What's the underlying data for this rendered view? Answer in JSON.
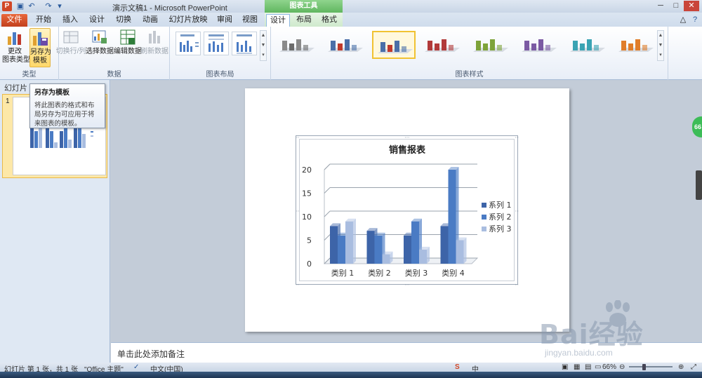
{
  "window": {
    "title": "演示文稿1 - Microsoft PowerPoint",
    "app_icon": "P",
    "context_tab_group": "图表工具"
  },
  "tabs": [
    "文件",
    "开始",
    "插入",
    "设计",
    "切换",
    "动画",
    "幻灯片放映",
    "审阅",
    "视图",
    "设计",
    "布局",
    "格式"
  ],
  "ribbon": {
    "groups": {
      "type": {
        "label": "类型",
        "buttons": [
          "更改\n图表类型",
          "另存为\n模板"
        ]
      },
      "data": {
        "label": "数据",
        "buttons": [
          "切换行/列",
          "选择数据",
          "编辑数据",
          "刷新数据"
        ]
      },
      "layouts": {
        "label": "图表布局"
      },
      "styles": {
        "label": "图表样式"
      }
    },
    "change_type_l1": "更改",
    "change_type_l2": "图表类型",
    "save_template_l1": "另存为",
    "save_template_l2": "模板",
    "switch_row_col": "切换行/列",
    "select_data": "选择数据",
    "edit_data": "编辑数据",
    "refresh_data": "刷新数据",
    "style_colors": [
      "#6b6b6b",
      "#4a6fa8",
      "#4a6fa8",
      "#b23a3a",
      "#7ea33a",
      "#7b5aa3",
      "#3aa3b3",
      "#e07d2a"
    ]
  },
  "slides_pane": {
    "tab_label": "幻灯片",
    "slide_number": "1"
  },
  "tooltip": {
    "title": "另存为模板",
    "body": "将此图表的格式和布局另存为可应用于将来图表的模板。"
  },
  "chart_data": {
    "type": "bar",
    "title": "销售报表",
    "categories": [
      "类别 1",
      "类别 2",
      "类别 3",
      "类别 4"
    ],
    "series": [
      {
        "name": "系列 1",
        "values": [
          8,
          7,
          6,
          8
        ],
        "color": "#3d64a8"
      },
      {
        "name": "系列 2",
        "values": [
          6,
          6,
          9,
          20
        ],
        "color": "#4a7bc4"
      },
      {
        "name": "系列 3",
        "values": [
          9,
          2,
          3,
          5
        ],
        "color": "#a9bde0"
      }
    ],
    "ylim": [
      0,
      20
    ],
    "yticks": [
      0,
      5,
      10,
      15,
      20
    ],
    "grid": true,
    "legend": "right"
  },
  "notes": {
    "placeholder": "单击此处添加备注"
  },
  "status": {
    "slide_info": "幻灯片 第 1 张，共 1 张",
    "theme": "\"Office 主题\"",
    "language": "中文(中国)",
    "zoom": "66%"
  },
  "side": {
    "badge": "66"
  },
  "watermark": {
    "brand": "Bai经验",
    "url": "jingyan.baidu.com"
  }
}
